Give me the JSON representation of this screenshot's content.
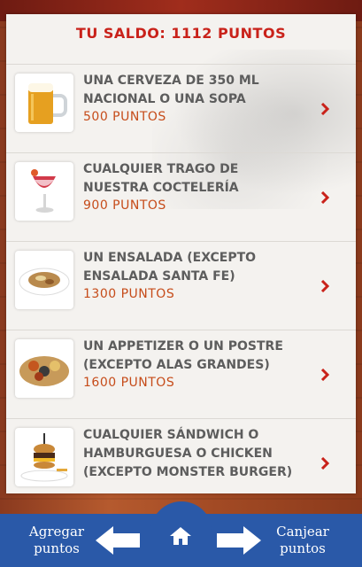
{
  "header": {
    "title": "TU SALDO: 1112 PUNTOS"
  },
  "rewards": [
    {
      "name": "UNA CERVEZA DE 350 ML NACIONAL O UNA SOPA",
      "points": "500 PUNTOS",
      "icon": "beer-mug-icon"
    },
    {
      "name": "CUALQUIER TRAGO DE NUESTRA COCTELERÍA",
      "points": "900 PUNTOS",
      "icon": "cocktail-icon"
    },
    {
      "name": "UN ENSALADA (EXCEPTO ENSALADA SANTA FE)",
      "points": "1300 PUNTOS",
      "icon": "salad-icon"
    },
    {
      "name": "UN APPETIZER O UN POSTRE (EXCEPTO ALAS GRANDES)",
      "points": "1600 PUNTOS",
      "icon": "appetizer-icon"
    },
    {
      "name": "CUALQUIER SÁNDWICH O HAMBURGUESA O CHICKEN (EXCEPTO MONSTER BURGER)",
      "points": "",
      "icon": "burger-icon"
    }
  ],
  "nav": {
    "left_label": "Agregar puntos",
    "right_label": "Canjear puntos",
    "home_icon": "home-icon"
  },
  "colors": {
    "accent_red": "#c9221a",
    "points_orange": "#c64c1a",
    "nav_blue": "#2a59a8",
    "text_gray": "#5d5d5d"
  }
}
